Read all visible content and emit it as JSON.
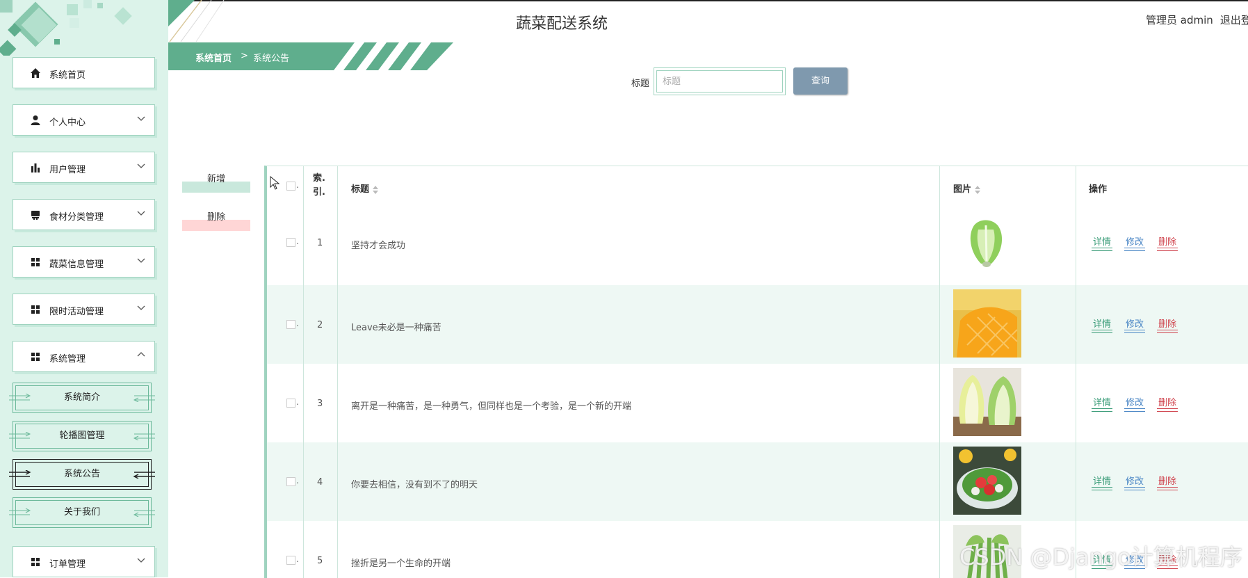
{
  "app": {
    "title": "蔬菜配送系统"
  },
  "header": {
    "user_label": "管理员 admin",
    "logout_label": "退出登"
  },
  "breadcrumb": {
    "home": "系统首页",
    "separator": ">",
    "current": "系统公告"
  },
  "sidebar": {
    "items": [
      {
        "label": "系统首页",
        "icon": "home-icon"
      },
      {
        "label": "个人中心",
        "icon": "user-icon"
      },
      {
        "label": "用户管理",
        "icon": "bar-chart-icon"
      },
      {
        "label": "食材分类管理",
        "icon": "store-icon"
      },
      {
        "label": "蔬菜信息管理",
        "icon": "grid-icon"
      },
      {
        "label": "限时活动管理",
        "icon": "grid-icon"
      },
      {
        "label": "系统管理",
        "icon": "grid-icon"
      },
      {
        "label": "订单管理",
        "icon": "grid-icon"
      }
    ],
    "sub_items": [
      {
        "label": "系统简介"
      },
      {
        "label": "轮播图管理"
      },
      {
        "label": "系统公告",
        "active": true
      },
      {
        "label": "关于我们"
      }
    ]
  },
  "search": {
    "label": "标题",
    "placeholder": "标题",
    "button": "查询"
  },
  "actions": {
    "add": "新增",
    "delete": "删除"
  },
  "table": {
    "headers": {
      "index": "索.引.",
      "title": "标题",
      "image": "图片",
      "ops": "操作"
    },
    "rows": [
      {
        "index": "1",
        "title": "坚持才会成功",
        "image": "cabbage"
      },
      {
        "index": "2",
        "title": "Leave未必是一种痛苦",
        "image": "mango"
      },
      {
        "index": "3",
        "title": "离开是一种痛苦，是一种勇气，但同样也是一个考验，是一个新的开端",
        "image": "napa-cabbage"
      },
      {
        "index": "4",
        "title": "你要去相信，没有到不了的明天",
        "image": "salad"
      },
      {
        "index": "5",
        "title": "挫折是另一个生命的开端",
        "image": "greens"
      }
    ],
    "ops": {
      "detail": "详情",
      "edit": "修改",
      "delete": "删除"
    }
  },
  "watermark": "CSDN @Django计算机程序",
  "colors": {
    "accent": "#5fae8d",
    "sidebar_bg": "#dcf3ea",
    "button": "#7f99ae",
    "alt_row": "#eef8f4",
    "detail": "#3a9c78",
    "edit": "#4a86c5",
    "delete": "#d0454f"
  }
}
